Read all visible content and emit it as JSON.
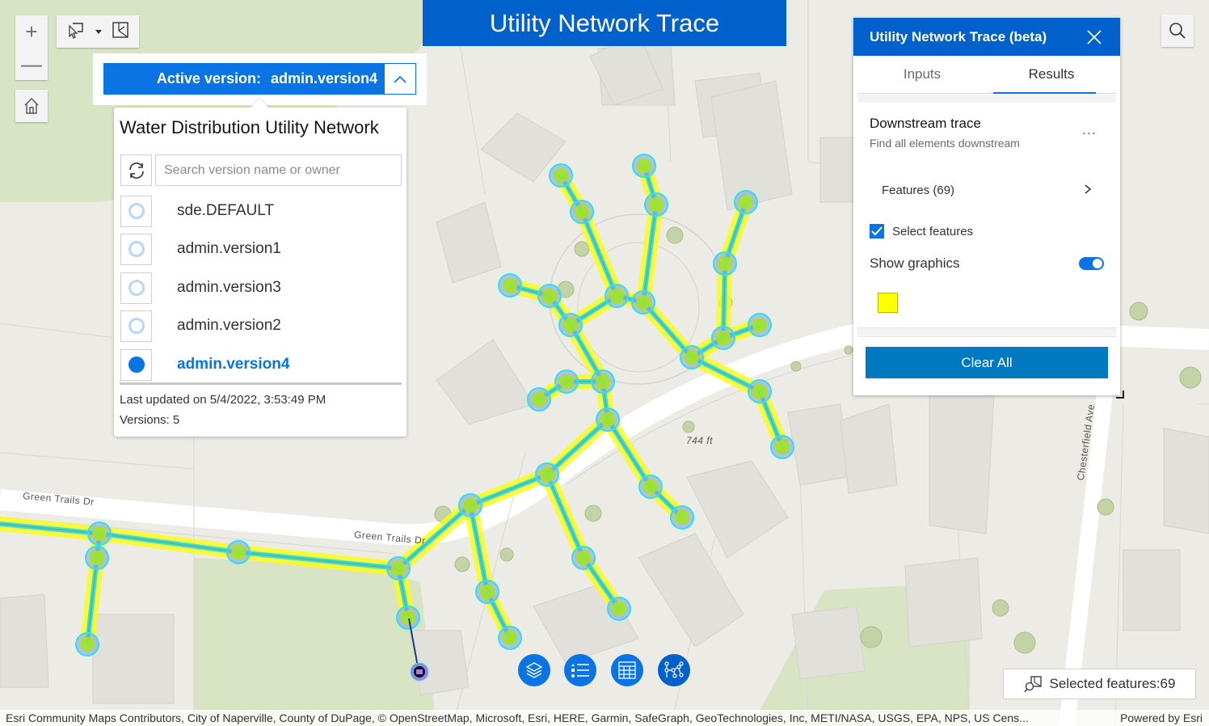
{
  "app": {
    "title": "Utility Network Trace"
  },
  "map_controls": {
    "zoom_in": "+",
    "zoom_out": "—",
    "home_icon": "home-icon",
    "select_icon": "select-by-rectangle-icon",
    "select_dropdown_icon": "caret-down-icon",
    "clear_selection_icon": "clear-selection-icon",
    "search_icon": "search-icon"
  },
  "version_manager": {
    "active_label": "Active version:",
    "active_value": "admin.version4",
    "panel_title": "Water Distribution Utility Network",
    "search_placeholder": "Search version name or owner",
    "versions": [
      {
        "name": "sde.DEFAULT",
        "selected": false
      },
      {
        "name": "admin.version1",
        "selected": false
      },
      {
        "name": "admin.version3",
        "selected": false
      },
      {
        "name": "admin.version2",
        "selected": false
      },
      {
        "name": "admin.version4",
        "selected": true
      }
    ],
    "last_updated": "Last updated on 5/4/2022, 3:53:49 PM",
    "versions_count": "Versions: 5"
  },
  "trace_panel": {
    "title": "Utility Network Trace (beta)",
    "tabs": [
      {
        "label": "Inputs",
        "active": false
      },
      {
        "label": "Results",
        "active": true
      }
    ],
    "trace_name": "Downstream trace",
    "trace_description": "Find all elements downstream",
    "more_label": "...",
    "features_label": "Features (69)",
    "select_features_label": "Select features",
    "select_features_checked": true,
    "show_graphics_label": "Show graphics",
    "show_graphics_on": true,
    "graphic_color": "#ffff00",
    "clear_all_label": "Clear All"
  },
  "map": {
    "street_labels": [
      "Green Trails Dr",
      "Green Trails Dr",
      "Chesterfield Ave"
    ],
    "elevation_label": "744 ft",
    "trace_color": "#ffff00",
    "line_color": "#29e6e6",
    "node_color": "#9ee62a"
  },
  "bottom_actions": [
    {
      "icon": "layers-icon"
    },
    {
      "icon": "legend-list-icon"
    },
    {
      "icon": "attribute-table-icon"
    },
    {
      "icon": "utility-network-icon"
    }
  ],
  "selection": {
    "label": "Selected features:69"
  },
  "attribution": {
    "sources": "Esri Community Maps Contributors, City of Naperville, County of DuPage, © OpenStreetMap, Microsoft, Esri, HERE, Garmin, SafeGraph, GeoTechnologies, Inc, METI/NASA, USGS, EPA, NPS, US Cens...",
    "powered_by": "Powered by Esri"
  },
  "colors": {
    "brand_blue": "#0060cc",
    "accent_blue": "#0a74e4",
    "button_blue": "#0079c1"
  }
}
